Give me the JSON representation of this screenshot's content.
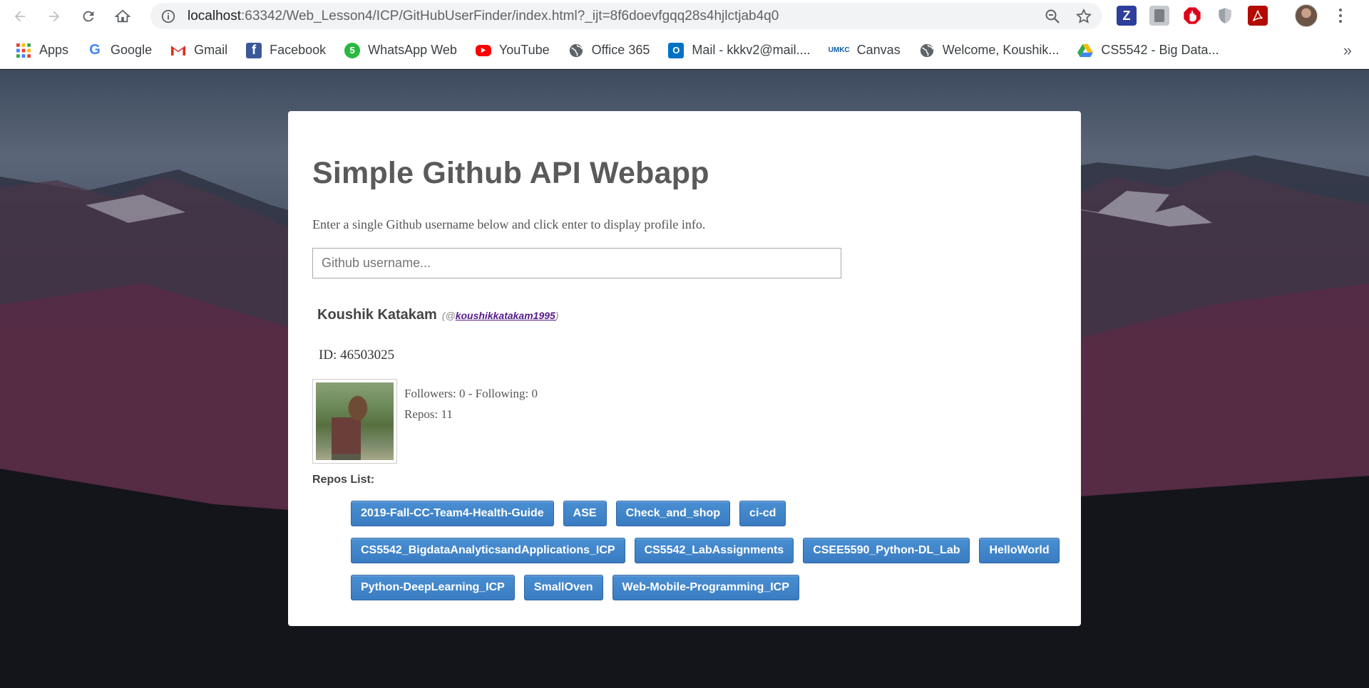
{
  "browser": {
    "url_host": "localhost",
    "url_rest": ":63342/Web_Lesson4/ICP/GitHubUserFinder/index.html?_ijt=8f6doevfgqq28s4hjlctjab4q0",
    "extensions": [
      {
        "label": "Z",
        "color": "#2d3e9c"
      },
      {
        "label": "",
        "color": "#9aa0a6"
      },
      {
        "label": "",
        "color": "#e0001a"
      },
      {
        "label": "",
        "color": "#9aa0a6"
      },
      {
        "label": "",
        "color": "#b30b00"
      }
    ]
  },
  "bookmarks": [
    {
      "label": "Apps",
      "icon": "apps-grid-icon"
    },
    {
      "label": "Google",
      "icon": "google-icon"
    },
    {
      "label": "Gmail",
      "icon": "gmail-icon"
    },
    {
      "label": "Facebook",
      "icon": "facebook-icon"
    },
    {
      "label": "WhatsApp Web",
      "icon": "whatsapp-icon"
    },
    {
      "label": "YouTube",
      "icon": "youtube-icon"
    },
    {
      "label": "Office 365",
      "icon": "globe-icon"
    },
    {
      "label": "Mail - kkkv2@mail....",
      "icon": "outlook-icon"
    },
    {
      "label": "Canvas",
      "icon": "umkc-icon"
    },
    {
      "label": "Welcome, Koushik...",
      "icon": "globe-icon"
    },
    {
      "label": "CS5542 - Big Data...",
      "icon": "google-drive-icon"
    }
  ],
  "bookmarks_more": "»",
  "app": {
    "title": "Simple Github API Webapp",
    "instructions": "Enter a single Github username below and click enter to display profile info.",
    "search_placeholder": "Github username...",
    "profile": {
      "name": "Koushik Katakam",
      "handle_prefix": "(@",
      "handle": "koushikkatakam1995",
      "handle_suffix": ")",
      "id_text": "ID: 46503025",
      "followers_text": "Followers: 0 - Following: 0",
      "repos_text": "Repos: 11"
    },
    "repos_label": "Repos List:",
    "repos": [
      "2019-Fall-CC-Team4-Health-Guide",
      "ASE",
      "Check_and_shop",
      "ci-cd",
      "CS5542_BigdataAnalyticsandApplications_ICP",
      "CS5542_LabAssignments",
      "CSEE5590_Python-DL_Lab",
      "HelloWorld",
      "Python-DeepLearning_ICP",
      "SmallOven",
      "Web-Mobile-Programming_ICP"
    ]
  },
  "colors": {
    "repo_button": "#3a7cc1",
    "handle_link": "#551a8b",
    "title_text": "#5a5a5a"
  }
}
